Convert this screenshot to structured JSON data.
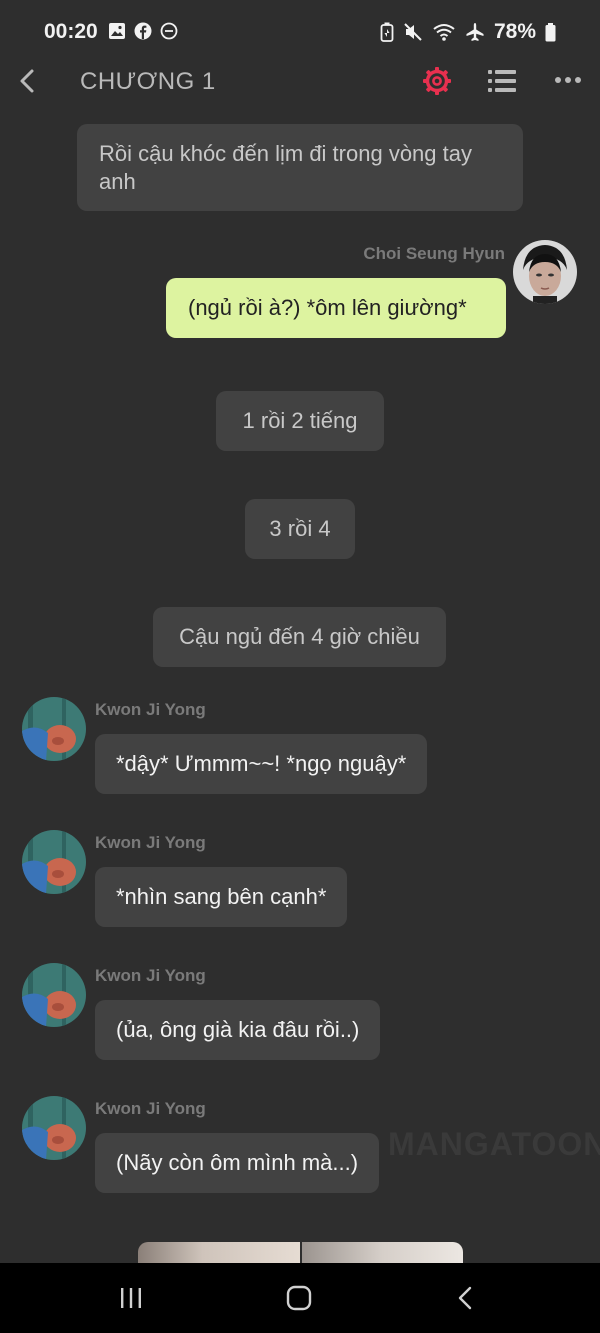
{
  "status_bar": {
    "time": "00:20",
    "battery": "78%",
    "left_icons": [
      "gallery-icon",
      "facebook-icon",
      "dnd-icon"
    ],
    "right_icons": [
      "battery-saver-icon",
      "mute-icon",
      "wifi-icon",
      "airplane-icon",
      "battery-icon"
    ]
  },
  "top_bar": {
    "title": "CHƯƠNG 1",
    "accent_color": "#e8304f"
  },
  "messages": [
    {
      "type": "narration",
      "text": "Rồi cậu khóc đến lịm đi trong vòng tay anh"
    },
    {
      "type": "right",
      "sender": "Choi Seung Hyun",
      "text": "(ngủ rồi à?) *ôm  lên giường*"
    },
    {
      "type": "narration",
      "text": "1 rồi 2 tiếng"
    },
    {
      "type": "narration",
      "text": "3 rồi 4"
    },
    {
      "type": "narration",
      "text": "Cậu ngủ đến 4 giờ chiều"
    },
    {
      "type": "left",
      "sender": "Kwon Ji Yong",
      "text": "*dậy* Ưmmm~~! *ngọ nguậy*"
    },
    {
      "type": "left",
      "sender": "Kwon Ji Yong",
      "text": "*nhìn sang bên cạnh*"
    },
    {
      "type": "left",
      "sender": "Kwon Ji Yong",
      "text": "(ủa, ông già kia đâu rồi..)"
    },
    {
      "type": "left",
      "sender": "Kwon Ji Yong",
      "text": "(Nãy còn ôm mình mà...)"
    }
  ],
  "watermark": "MANGATOON",
  "colors": {
    "background": "#2e2e2e",
    "bubble": "#424242",
    "right_bubble": "#ddf3a0"
  }
}
